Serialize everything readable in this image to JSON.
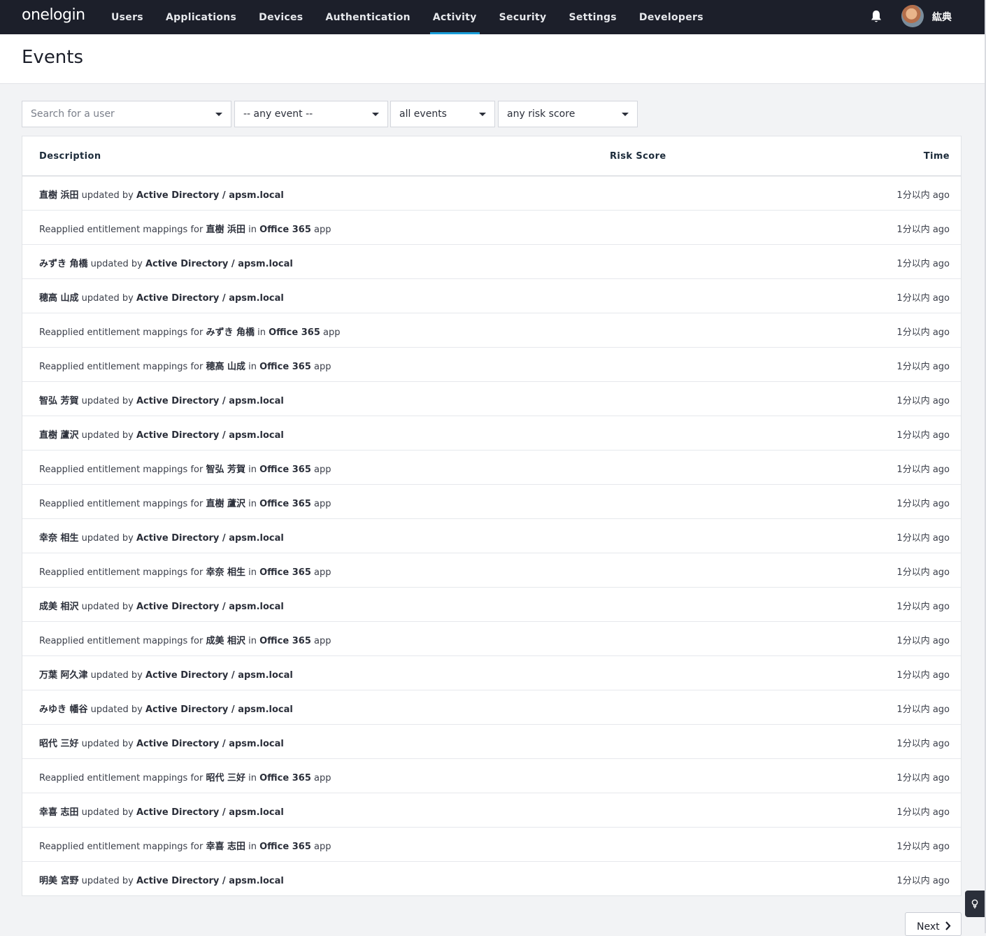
{
  "app": {
    "logo": "onelogin",
    "username": "紘典"
  },
  "nav": [
    {
      "label": "Users",
      "active": false
    },
    {
      "label": "Applications",
      "active": false
    },
    {
      "label": "Devices",
      "active": false
    },
    {
      "label": "Authentication",
      "active": false
    },
    {
      "label": "Activity",
      "active": true
    },
    {
      "label": "Security",
      "active": false
    },
    {
      "label": "Settings",
      "active": false
    },
    {
      "label": "Developers",
      "active": false
    }
  ],
  "page": {
    "title": "Events"
  },
  "filters": {
    "user": {
      "placeholder": "Search for a user"
    },
    "event_type": {
      "value": "-- any event --"
    },
    "event_scope": {
      "value": "all events"
    },
    "risk": {
      "value": "any risk score"
    }
  },
  "table": {
    "columns": [
      "Description",
      "Risk Score",
      "Time"
    ],
    "rows": [
      {
        "parts": [
          {
            "t": "直樹 浜田",
            "b": true
          },
          {
            "t": " updated by "
          },
          {
            "t": "Active Directory / apsm.local",
            "b": true
          }
        ],
        "time": "1分以内 ago"
      },
      {
        "parts": [
          {
            "t": "Reapplied entitlement mappings for "
          },
          {
            "t": "直樹 浜田",
            "b": true
          },
          {
            "t": " in "
          },
          {
            "t": "Office 365",
            "b": true
          },
          {
            "t": " app"
          }
        ],
        "time": "1分以内 ago"
      },
      {
        "parts": [
          {
            "t": "みずき 角橋",
            "b": true
          },
          {
            "t": " updated by "
          },
          {
            "t": "Active Directory / apsm.local",
            "b": true
          }
        ],
        "time": "1分以内 ago"
      },
      {
        "parts": [
          {
            "t": "穂高 山成",
            "b": true
          },
          {
            "t": " updated by "
          },
          {
            "t": "Active Directory / apsm.local",
            "b": true
          }
        ],
        "time": "1分以内 ago"
      },
      {
        "parts": [
          {
            "t": "Reapplied entitlement mappings for "
          },
          {
            "t": "みずき 角橋",
            "b": true
          },
          {
            "t": " in "
          },
          {
            "t": "Office 365",
            "b": true
          },
          {
            "t": " app"
          }
        ],
        "time": "1分以内 ago"
      },
      {
        "parts": [
          {
            "t": "Reapplied entitlement mappings for "
          },
          {
            "t": "穂高 山成",
            "b": true
          },
          {
            "t": " in "
          },
          {
            "t": "Office 365",
            "b": true
          },
          {
            "t": " app"
          }
        ],
        "time": "1分以内 ago"
      },
      {
        "parts": [
          {
            "t": "智弘 芳賀",
            "b": true
          },
          {
            "t": " updated by "
          },
          {
            "t": "Active Directory / apsm.local",
            "b": true
          }
        ],
        "time": "1分以内 ago"
      },
      {
        "parts": [
          {
            "t": "直樹 蘆沢",
            "b": true
          },
          {
            "t": " updated by "
          },
          {
            "t": "Active Directory / apsm.local",
            "b": true
          }
        ],
        "time": "1分以内 ago"
      },
      {
        "parts": [
          {
            "t": "Reapplied entitlement mappings for "
          },
          {
            "t": "智弘 芳賀",
            "b": true
          },
          {
            "t": " in "
          },
          {
            "t": "Office 365",
            "b": true
          },
          {
            "t": " app"
          }
        ],
        "time": "1分以内 ago"
      },
      {
        "parts": [
          {
            "t": "Reapplied entitlement mappings for "
          },
          {
            "t": "直樹 蘆沢",
            "b": true
          },
          {
            "t": " in "
          },
          {
            "t": "Office 365",
            "b": true
          },
          {
            "t": " app"
          }
        ],
        "time": "1分以内 ago"
      },
      {
        "parts": [
          {
            "t": "幸奈 相生",
            "b": true
          },
          {
            "t": " updated by "
          },
          {
            "t": "Active Directory / apsm.local",
            "b": true
          }
        ],
        "time": "1分以内 ago"
      },
      {
        "parts": [
          {
            "t": "Reapplied entitlement mappings for "
          },
          {
            "t": "幸奈 相生",
            "b": true
          },
          {
            "t": " in "
          },
          {
            "t": "Office 365",
            "b": true
          },
          {
            "t": " app"
          }
        ],
        "time": "1分以内 ago"
      },
      {
        "parts": [
          {
            "t": "成美 相沢",
            "b": true
          },
          {
            "t": " updated by "
          },
          {
            "t": "Active Directory / apsm.local",
            "b": true
          }
        ],
        "time": "1分以内 ago"
      },
      {
        "parts": [
          {
            "t": "Reapplied entitlement mappings for "
          },
          {
            "t": "成美 相沢",
            "b": true
          },
          {
            "t": " in "
          },
          {
            "t": "Office 365",
            "b": true
          },
          {
            "t": " app"
          }
        ],
        "time": "1分以内 ago"
      },
      {
        "parts": [
          {
            "t": "万葉 阿久津",
            "b": true
          },
          {
            "t": " updated by "
          },
          {
            "t": "Active Directory / apsm.local",
            "b": true
          }
        ],
        "time": "1分以内 ago"
      },
      {
        "parts": [
          {
            "t": "みゆき 幡谷",
            "b": true
          },
          {
            "t": " updated by "
          },
          {
            "t": "Active Directory / apsm.local",
            "b": true
          }
        ],
        "time": "1分以内 ago"
      },
      {
        "parts": [
          {
            "t": "昭代 三好",
            "b": true
          },
          {
            "t": " updated by "
          },
          {
            "t": "Active Directory / apsm.local",
            "b": true
          }
        ],
        "time": "1分以内 ago"
      },
      {
        "parts": [
          {
            "t": "Reapplied entitlement mappings for "
          },
          {
            "t": "昭代 三好",
            "b": true
          },
          {
            "t": " in "
          },
          {
            "t": "Office 365",
            "b": true
          },
          {
            "t": " app"
          }
        ],
        "time": "1分以内 ago"
      },
      {
        "parts": [
          {
            "t": "幸喜 志田",
            "b": true
          },
          {
            "t": " updated by "
          },
          {
            "t": "Active Directory / apsm.local",
            "b": true
          }
        ],
        "time": "1分以内 ago"
      },
      {
        "parts": [
          {
            "t": "Reapplied entitlement mappings for "
          },
          {
            "t": "幸喜 志田",
            "b": true
          },
          {
            "t": " in "
          },
          {
            "t": "Office 365",
            "b": true
          },
          {
            "t": " app"
          }
        ],
        "time": "1分以内 ago"
      },
      {
        "parts": [
          {
            "t": "明美 宮野",
            "b": true
          },
          {
            "t": " updated by "
          },
          {
            "t": "Active Directory / apsm.local",
            "b": true
          }
        ],
        "time": "1分以内 ago"
      }
    ]
  },
  "pagination": {
    "next_label": "Next"
  },
  "icons": {
    "notifications": "bell-icon",
    "next": "chevron-right-icon",
    "help": "lightbulb-icon"
  },
  "colors": {
    "nav_bg": "#1c1f2a",
    "accent": "#1a9ed9"
  }
}
